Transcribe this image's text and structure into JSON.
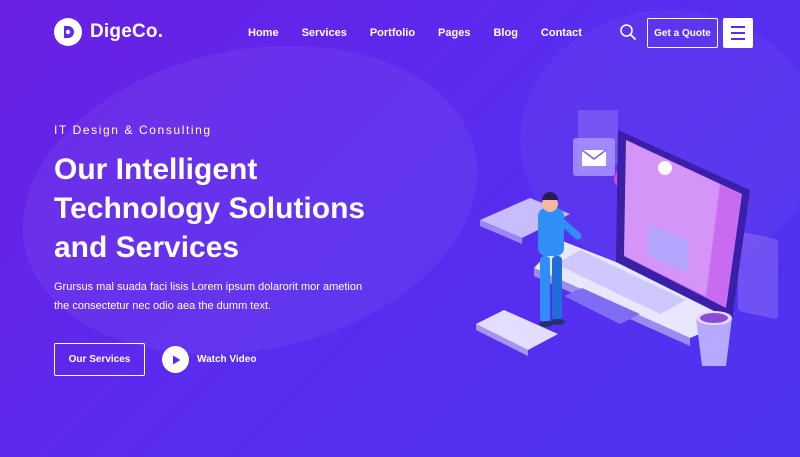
{
  "brand": {
    "name": "DigeCo.",
    "accent": "#5b2bef"
  },
  "nav": [
    "Home",
    "Services",
    "Portfolio",
    "Pages",
    "Blog",
    "Contact"
  ],
  "header": {
    "quote_label": "Get a Quote",
    "search_icon": "search-icon",
    "menu_icon": "hamburger-icon"
  },
  "hero": {
    "eyebrow": "IT Design & Consulting",
    "title_lines": [
      "Our Intelligent",
      "Technology Solutions",
      "and Services"
    ],
    "description_lines": [
      "Grursus mal suada faci lisis Lorem ipsum dolarorit mor ametion",
      "the consectetur nec odio aea the dumm text."
    ],
    "primary_label": "Our Services",
    "video_label": "Watch Video"
  }
}
